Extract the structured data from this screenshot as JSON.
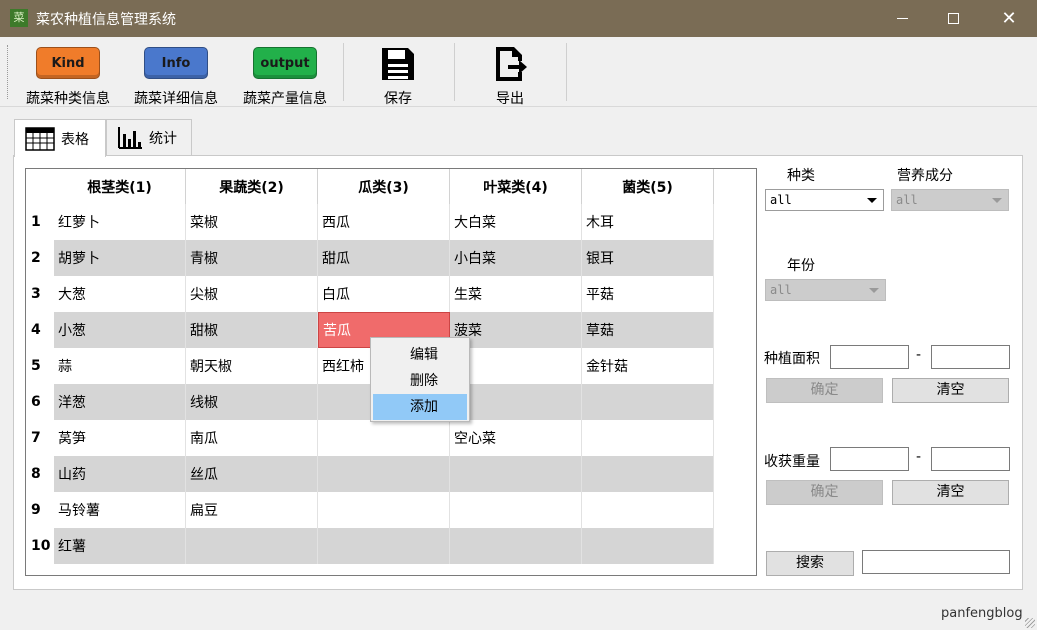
{
  "window": {
    "title": "菜农种植信息管理系统",
    "app_icon_text": "菜",
    "close_glyph": "✕"
  },
  "toolbar": {
    "kind": {
      "badge": "Kind",
      "label": "蔬菜种类信息",
      "color": "#f07c2a"
    },
    "info": {
      "badge": "Info",
      "label": "蔬菜详细信息",
      "color": "#4a78cc"
    },
    "output": {
      "badge": "output",
      "label": "蔬菜产量信息",
      "color": "#22b04a"
    },
    "save_label": "保存",
    "export_label": "导出"
  },
  "tabs": [
    {
      "label": "表格",
      "active": true,
      "icon": "table-icon"
    },
    {
      "label": "统计",
      "active": false,
      "icon": "bar-chart-icon"
    }
  ],
  "table": {
    "columns": [
      "根茎类(1)",
      "果蔬类(2)",
      "瓜类(3)",
      "叶菜类(4)",
      "菌类(5)"
    ],
    "row_numbers": [
      "1",
      "2",
      "3",
      "4",
      "5",
      "6",
      "7",
      "8",
      "9",
      "10"
    ],
    "rows": [
      [
        "红萝卜",
        "菜椒",
        "西瓜",
        "大白菜",
        "木耳"
      ],
      [
        "胡萝卜",
        "青椒",
        "甜瓜",
        "小白菜",
        "银耳"
      ],
      [
        "大葱",
        "尖椒",
        "白瓜",
        "生菜",
        "平菇"
      ],
      [
        "小葱",
        "甜椒",
        "苦瓜",
        "菠菜",
        "草菇"
      ],
      [
        "蒜",
        "朝天椒",
        "西红柿",
        "菜",
        "金针菇"
      ],
      [
        "洋葱",
        "线椒",
        "",
        "菜",
        ""
      ],
      [
        "莴笋",
        "南瓜",
        "",
        "空心菜",
        ""
      ],
      [
        "山药",
        "丝瓜",
        "",
        "",
        ""
      ],
      [
        "马铃薯",
        "扁豆",
        "",
        "",
        ""
      ],
      [
        "红薯",
        "",
        "",
        "",
        ""
      ]
    ],
    "selected_cell": {
      "row": 4,
      "column": 3
    },
    "selected_color": "#f06b6b",
    "stripe_color": "#d5d5d5"
  },
  "context_menu": {
    "items": [
      "编辑",
      "删除",
      "添加"
    ],
    "highlighted": "添加"
  },
  "filters": {
    "kind_label": "种类",
    "kind_value": "all",
    "nutrition_label": "营养成分",
    "nutrition_value": "all",
    "year_label": "年份",
    "year_value": "all",
    "area_label": "种植面积",
    "area_dash": "-",
    "area_confirm": "确定",
    "area_clear": "清空",
    "weight_label": "收获重量",
    "weight_dash": "-",
    "weight_confirm": "确定",
    "weight_clear": "清空",
    "search_label": "搜索"
  },
  "watermark": "panfengblog"
}
